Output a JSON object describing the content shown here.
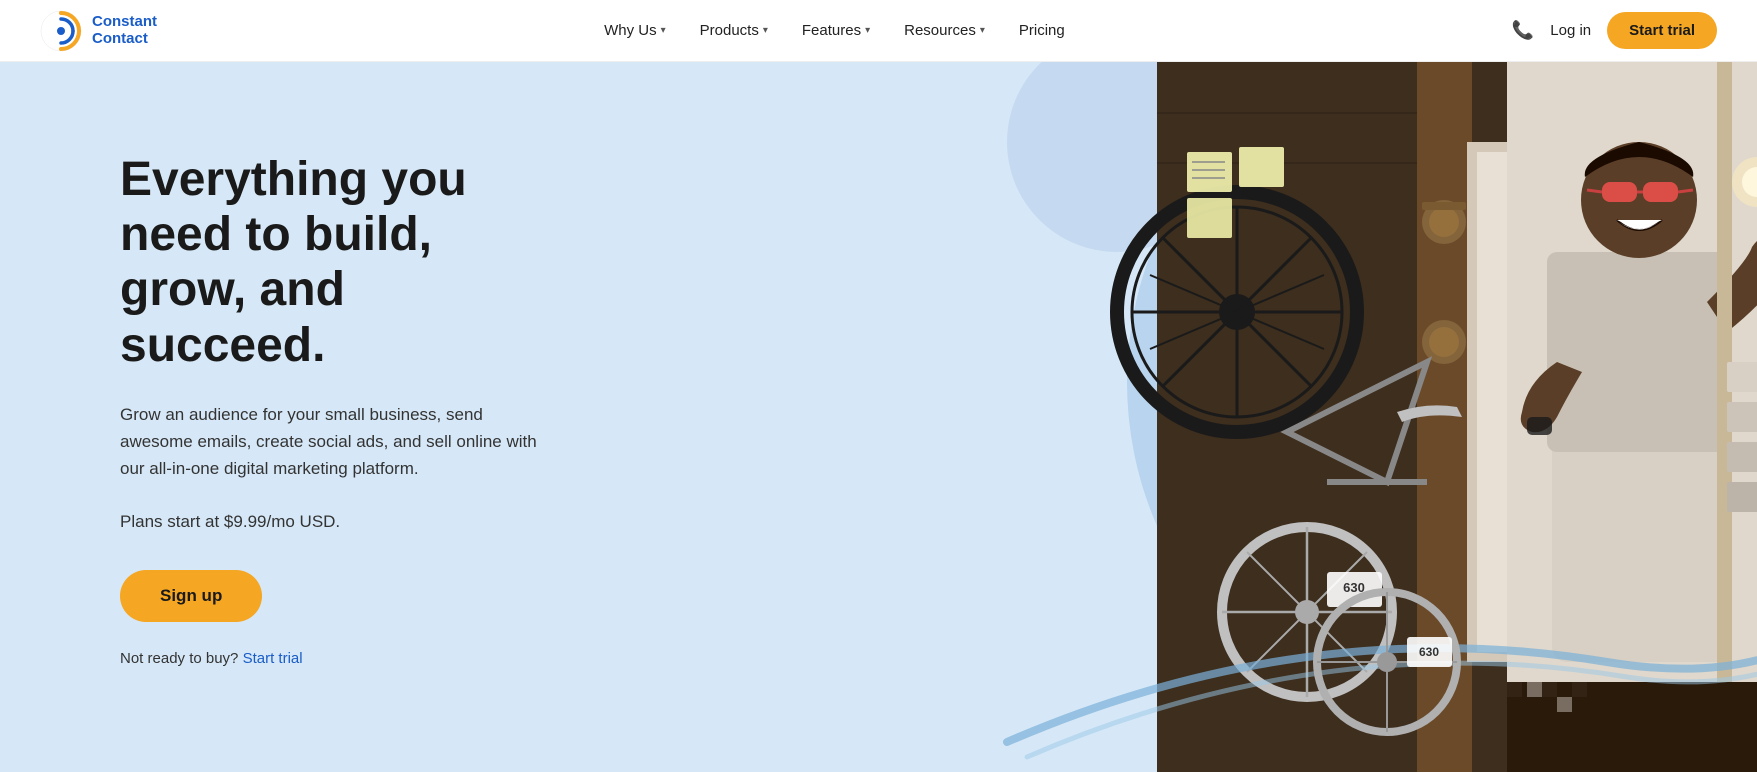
{
  "logo": {
    "line1": "Constant",
    "line2": "Contact",
    "alt": "Constant Contact"
  },
  "nav": {
    "items": [
      {
        "label": "Why Us",
        "hasDropdown": true
      },
      {
        "label": "Products",
        "hasDropdown": true
      },
      {
        "label": "Features",
        "hasDropdown": true
      },
      {
        "label": "Resources",
        "hasDropdown": true
      },
      {
        "label": "Pricing",
        "hasDropdown": false
      }
    ],
    "login_label": "Log in",
    "start_trial_label": "Start trial"
  },
  "hero": {
    "title": "Everything you need to build, grow, and succeed.",
    "subtitle": "Grow an audience for your small business, send awesome emails, create social ads, and sell online with our all-in-one digital marketing platform.",
    "pricing": "Plans start at $9.99/mo USD.",
    "signup_label": "Sign up",
    "not_ready_text": "Not ready to buy?",
    "start_trial_link": "Start trial"
  },
  "colors": {
    "hero_bg": "#d6e8f7",
    "circle_bg": "#b8d4ee",
    "accent_orange": "#f5a623",
    "logo_blue": "#1a5dc8",
    "link_blue": "#1a5dc8"
  }
}
